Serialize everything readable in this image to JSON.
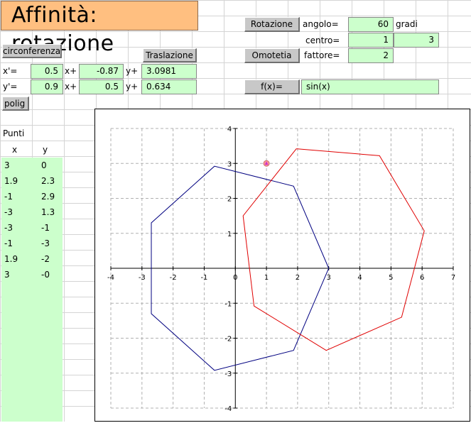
{
  "title": "Affinità: rotazione",
  "buttons": {
    "circonferenza": "circonferenza",
    "traslazione": "Traslazione",
    "polig": "polig",
    "rotazione": "Rotazione",
    "omotetia": "Omotetia",
    "fx": "f(x)="
  },
  "rotation": {
    "angolo_label": "angolo=",
    "angolo_value": "60",
    "angolo_unit": "gradi",
    "centro_label": "centro=",
    "centro_x": "1",
    "centro_y": "3",
    "fattore_label": "fattore=",
    "fattore_value": "2"
  },
  "function": {
    "expr": "sin(x)"
  },
  "transform": {
    "row1": {
      "lhs": "x'=",
      "a": "0.5",
      "op1": "x+",
      "b": "-0.87",
      "op2": "y+",
      "c": "3.0981"
    },
    "row2": {
      "lhs": "y'=",
      "a": "0.9",
      "op1": "x+",
      "b": "0.5",
      "op2": "y+",
      "c": "0.634"
    }
  },
  "points": {
    "header": "Punti",
    "col_x": "x",
    "col_y": "y",
    "rows": [
      {
        "x": "3",
        "y": "0"
      },
      {
        "x": "1.9",
        "y": "2.3"
      },
      {
        "x": "-1",
        "y": "2.9"
      },
      {
        "x": "-3",
        "y": "1.3"
      },
      {
        "x": "-3",
        "y": "-1"
      },
      {
        "x": "-1",
        "y": "-3"
      },
      {
        "x": "1.9",
        "y": "-2"
      },
      {
        "x": "3",
        "y": "-0"
      }
    ]
  },
  "chart_data": {
    "type": "line",
    "xlim": [
      -4,
      7
    ],
    "ylim": [
      -4,
      4
    ],
    "xticks": [
      "-4",
      "-3",
      "-2",
      "-1",
      "0",
      "1",
      "2",
      "3",
      "4",
      "5",
      "6",
      "7"
    ],
    "yticks": [
      "4",
      "3",
      "2",
      "1",
      "0",
      "-1",
      "-2",
      "-3",
      "-4"
    ],
    "grid": true,
    "series": [
      {
        "color": "#000080",
        "points": [
          [
            3,
            0
          ],
          [
            1.87,
            2.35
          ],
          [
            -0.67,
            2.92
          ],
          [
            -2.7,
            1.3
          ],
          [
            -2.7,
            -1.3
          ],
          [
            -0.67,
            -2.92
          ],
          [
            1.87,
            -2.35
          ],
          [
            3,
            0
          ]
        ]
      },
      {
        "color": "#e00000",
        "points": [
          [
            1.96,
            3.42
          ],
          [
            4.63,
            3.22
          ],
          [
            6.07,
            1.07
          ],
          [
            5.34,
            -1.4
          ],
          [
            2.92,
            -2.35
          ],
          [
            0.6,
            -1.08
          ],
          [
            0.25,
            1.5
          ],
          [
            1.96,
            3.42
          ]
        ]
      }
    ],
    "marker": {
      "x": 1,
      "y": 3,
      "color": "#ff9999"
    }
  }
}
